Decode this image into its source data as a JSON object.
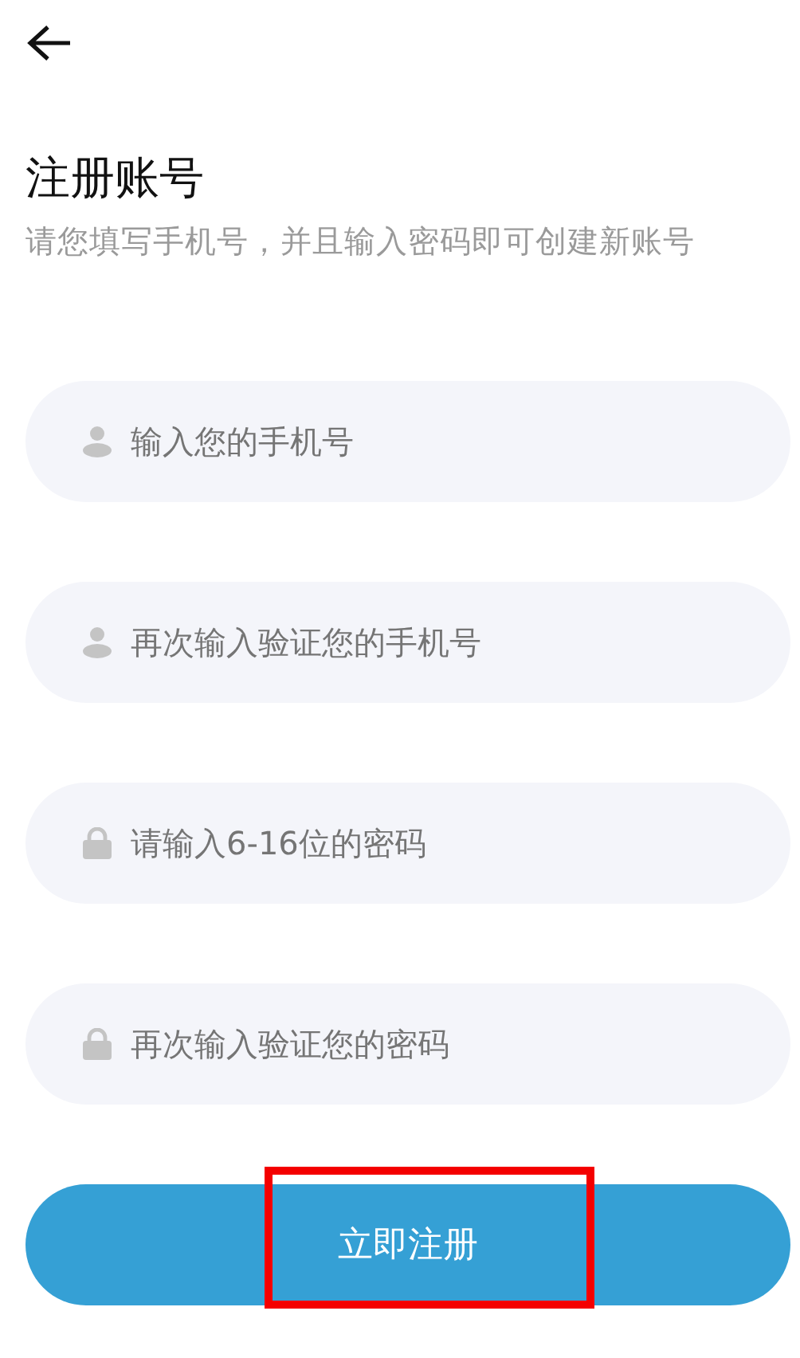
{
  "back": {
    "kind": "arrow"
  },
  "title": "注册账号",
  "subtitle": "请您填写手机号，并且输入密码即可创建新账号",
  "fields": [
    {
      "kind": "person",
      "placeholder": "输入您的手机号"
    },
    {
      "kind": "person",
      "placeholder": "再次输入验证您的手机号"
    },
    {
      "kind": "lock",
      "placeholder": "请输入6-16位的密码"
    },
    {
      "kind": "lock",
      "placeholder": "再次输入验证您的密码"
    }
  ],
  "submit": {
    "label": "立即注册",
    "highlighted": true
  }
}
